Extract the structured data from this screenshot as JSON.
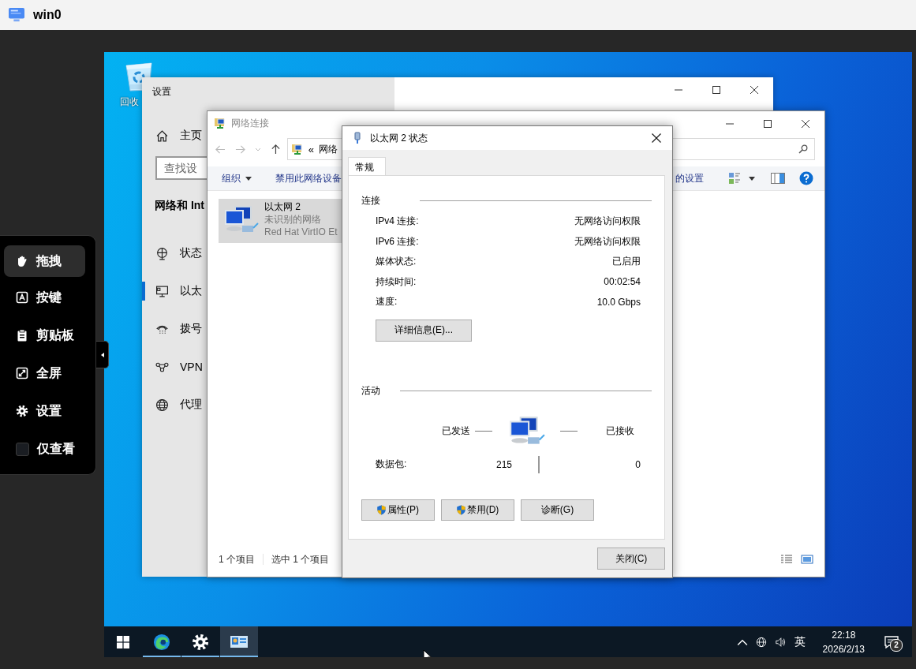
{
  "app_bar": {
    "title": "win0"
  },
  "toolbar": {
    "items": [
      {
        "kind": "button",
        "label": "拖拽",
        "selected": true
      },
      {
        "kind": "button",
        "label": "按键",
        "selected": false
      },
      {
        "kind": "button",
        "label": "剪贴板",
        "selected": false
      },
      {
        "kind": "button",
        "label": "全屏",
        "selected": false
      },
      {
        "kind": "button",
        "label": "设置",
        "selected": false
      },
      {
        "kind": "checkbox",
        "label": "仅查看",
        "checked": false
      }
    ]
  },
  "desktop": {
    "icons": [
      {
        "label": "回收"
      }
    ]
  },
  "settings_window": {
    "title": "设置",
    "home": "主页",
    "search": {
      "placeholder": "查找设"
    },
    "section": "网络和 Int",
    "nav": [
      {
        "label": "状态",
        "selected": false
      },
      {
        "label": "以太",
        "selected": true
      },
      {
        "label": "拨号",
        "selected": false
      },
      {
        "label": "VPN",
        "selected": false
      },
      {
        "label": "代理",
        "selected": false
      }
    ]
  },
  "network_window": {
    "title": "网络连接",
    "address": {
      "prefix": "«",
      "path": "网络"
    },
    "commands": [
      {
        "kind": "menu",
        "label": "组织"
      },
      {
        "kind": "plain",
        "label": "禁用此网络设备"
      },
      {
        "kind": "plain",
        "label": "的设置"
      }
    ],
    "items": [
      {
        "name": "以太网 2",
        "status": "未识别的网络",
        "device": "Red Hat VirtIO Et",
        "selected": true
      }
    ],
    "status_bar": [
      "1 个项目",
      "选中 1 个项目"
    ]
  },
  "dialog": {
    "title": "以太网 2 状态",
    "tabs": [
      {
        "label": "常规",
        "selected": true
      }
    ],
    "connection": {
      "heading": "连接",
      "rows": [
        {
          "label": "IPv4 连接:",
          "value": "无网络访问权限"
        },
        {
          "label": "IPv6 连接:",
          "value": "无网络访问权限"
        },
        {
          "label": "媒体状态:",
          "value": "已启用"
        },
        {
          "label": "持续时间:",
          "value": "00:02:54"
        },
        {
          "label": "速度:",
          "value": "10.0 Gbps"
        }
      ],
      "details_button": "详细信息(E)..."
    },
    "activity": {
      "heading": "活动",
      "sent_label": "已发送",
      "received_label": "已接收",
      "rows": [
        {
          "label": "数据包:",
          "sent": "215",
          "received": "0"
        }
      ]
    },
    "buttons": [
      {
        "label": "属性(P)",
        "shield": true
      },
      {
        "label": "禁用(D)",
        "shield": true
      },
      {
        "label": "诊断(G)",
        "shield": false
      }
    ],
    "close_button": "关闭(C)"
  },
  "taskbar": {
    "apps": [
      {
        "running": true,
        "selected": false
      },
      {
        "running": true,
        "selected": false
      },
      {
        "running": true,
        "selected": true
      }
    ],
    "language": "英",
    "time": "22:18",
    "date": "2026/2/13",
    "notifications": "2"
  }
}
